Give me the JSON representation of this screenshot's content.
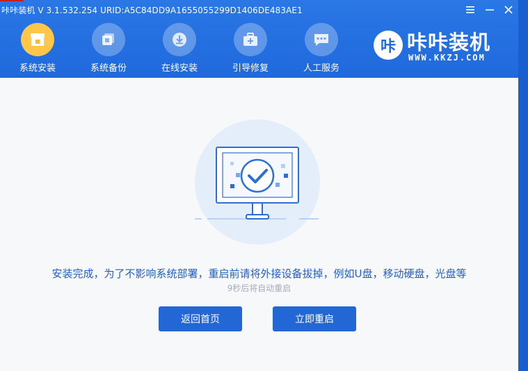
{
  "window": {
    "title": "咔咔装机 V 3.1.532.254 URID:A5C84DD9A1655055299D1406DE483AE1",
    "controls": [
      "menu-icon",
      "minimize-icon",
      "close-icon"
    ]
  },
  "nav": {
    "items": [
      {
        "label": "系统安装",
        "icon": "system-install-icon",
        "active": true
      },
      {
        "label": "系统备份",
        "icon": "system-backup-icon",
        "active": false
      },
      {
        "label": "在线安装",
        "icon": "online-install-icon",
        "active": false
      },
      {
        "label": "引导修复",
        "icon": "boot-repair-icon",
        "active": false
      },
      {
        "label": "人工服务",
        "icon": "chat-service-icon",
        "active": false
      }
    ]
  },
  "brand": {
    "logo_char": "咔",
    "name": "咔咔装机",
    "url": "WWW.KKZJ.COM"
  },
  "main": {
    "message": "安装完成，为了不影响系统部署，重启前请将外接设备拔掉，例如U盘，移动硬盘，光盘等",
    "countdown": "9秒后将自动重启",
    "back_label": "返回首页",
    "restart_label": "立即重启"
  },
  "colors": {
    "titlebar": "#1f69dc",
    "active_nav": "#ffc64a",
    "button": "#2367d6",
    "message_text": "#1f5fc7"
  }
}
